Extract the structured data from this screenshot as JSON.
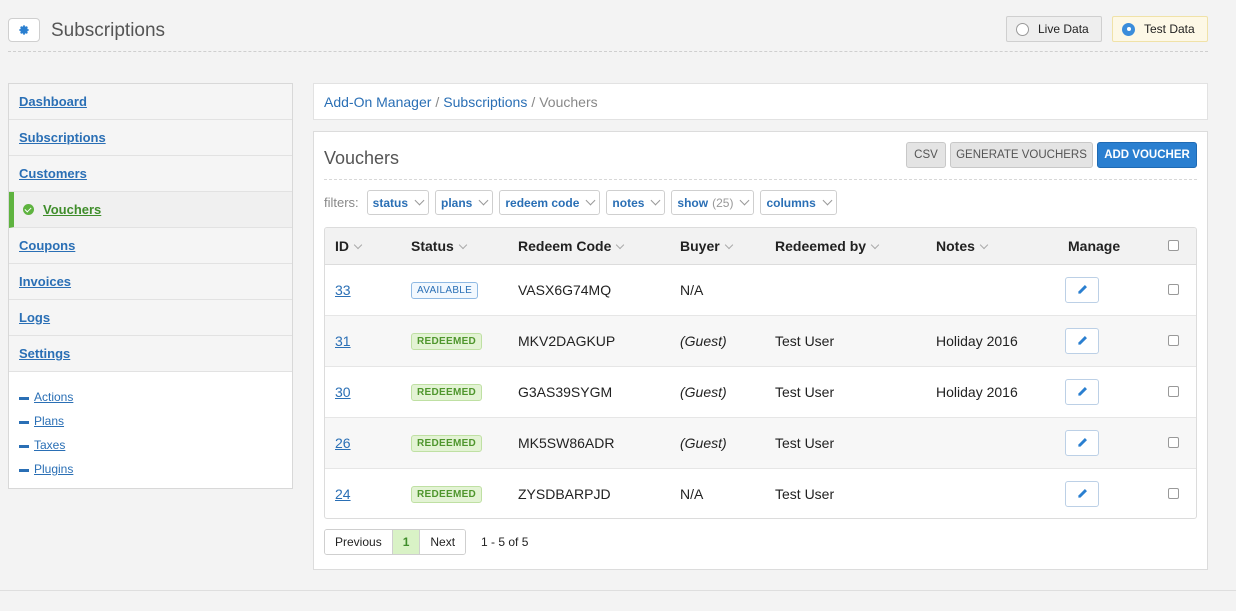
{
  "header": {
    "title": "Subscriptions",
    "live_label": "Live Data",
    "test_label": "Test Data",
    "selected_mode": "test"
  },
  "sidebar": {
    "items": [
      {
        "label": "Dashboard",
        "active": false
      },
      {
        "label": "Subscriptions",
        "active": false
      },
      {
        "label": "Customers",
        "active": false
      },
      {
        "label": "Vouchers",
        "active": true
      },
      {
        "label": "Coupons",
        "active": false
      },
      {
        "label": "Invoices",
        "active": false
      },
      {
        "label": "Logs",
        "active": false
      },
      {
        "label": "Settings",
        "active": false
      }
    ],
    "sub_links": [
      "Actions",
      "Plans",
      "Taxes",
      "Plugins"
    ]
  },
  "breadcrumb": {
    "items": [
      "Add-On Manager",
      "Subscriptions"
    ],
    "current": "Vouchers"
  },
  "panel": {
    "title": "Vouchers",
    "csv_label": "CSV",
    "generate_label": "GENERATE VOUCHERS",
    "add_label": "ADD VOUCHER"
  },
  "filters": {
    "label": "filters:",
    "items": [
      {
        "label": "status"
      },
      {
        "label": "plans"
      },
      {
        "label": "redeem code"
      },
      {
        "label": "notes"
      },
      {
        "label": "show",
        "count": "(25)"
      },
      {
        "label": "columns"
      }
    ]
  },
  "table": {
    "columns": [
      "ID",
      "Status",
      "Redeem Code",
      "Buyer",
      "Redeemed by",
      "Notes",
      "Manage"
    ],
    "rows": [
      {
        "id": "33",
        "status": "AVAILABLE",
        "code": "VASX6G74MQ",
        "buyer": "N/A",
        "redeemed_by": "",
        "notes": ""
      },
      {
        "id": "31",
        "status": "REDEEMED",
        "code": "MKV2DAGKUP",
        "buyer": "(Guest)",
        "redeemed_by": "Test User",
        "notes": "Holiday 2016"
      },
      {
        "id": "30",
        "status": "REDEEMED",
        "code": "G3AS39SYGM",
        "buyer": "(Guest)",
        "redeemed_by": "Test User",
        "notes": "Holiday 2016"
      },
      {
        "id": "26",
        "status": "REDEEMED",
        "code": "MK5SW86ADR",
        "buyer": "(Guest)",
        "redeemed_by": "Test User",
        "notes": ""
      },
      {
        "id": "24",
        "status": "REDEEMED",
        "code": "ZYSDBARPJD",
        "buyer": "N/A",
        "redeemed_by": "Test User",
        "notes": ""
      }
    ]
  },
  "pagination": {
    "prev_label": "Previous",
    "current_page": "1",
    "next_label": "Next",
    "range_text": "1 - 5 of 5"
  },
  "icons": {
    "settings": "gear-icon",
    "active_nav": "check-circle-icon",
    "edit": "pencil-icon",
    "sort": "chevron-down-icon"
  },
  "colors": {
    "accent": "#2a7fd0",
    "link": "#2a6fb5",
    "success": "#5eb33f",
    "test_mode_bg": "#fdf8e6"
  }
}
